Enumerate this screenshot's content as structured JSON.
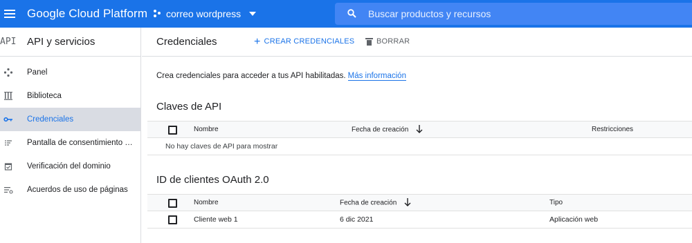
{
  "topbar": {
    "brand": "Google Cloud Platform",
    "project": "correo wordpress",
    "search_placeholder": "Buscar productos y recursos",
    "bg_color": "#1a73e8"
  },
  "sidebar": {
    "logo_text": "API",
    "title": "API y servicios",
    "items": [
      {
        "label": "Panel",
        "icon": "dashboard-icon",
        "active": false
      },
      {
        "label": "Biblioteca",
        "icon": "library-icon",
        "active": false
      },
      {
        "label": "Credenciales",
        "icon": "key-icon",
        "active": true
      },
      {
        "label": "Pantalla de consentimiento …",
        "icon": "consent-icon",
        "active": false
      },
      {
        "label": "Verificación del dominio",
        "icon": "domain-check-icon",
        "active": false
      },
      {
        "label": "Acuerdos de uso de páginas",
        "icon": "settings-list-icon",
        "active": false
      }
    ]
  },
  "main": {
    "title": "Credenciales",
    "create_button": "CREAR CREDENCIALES",
    "delete_button": "BORRAR",
    "description": "Crea credenciales para acceder a tus API habilitadas.",
    "more_info_link": "Más información",
    "api_keys": {
      "title": "Claves de API",
      "columns": [
        "Nombre",
        "Fecha de creación",
        "Restricciones"
      ],
      "empty_message": "No hay claves de API para mostrar"
    },
    "oauth": {
      "title": "ID de clientes OAuth 2.0",
      "columns": [
        "Nombre",
        "Fecha de creación",
        "Tipo"
      ],
      "rows": [
        {
          "name": "Cliente web 1",
          "date": "6 dic 2021",
          "type": "Aplicación web"
        }
      ]
    }
  }
}
